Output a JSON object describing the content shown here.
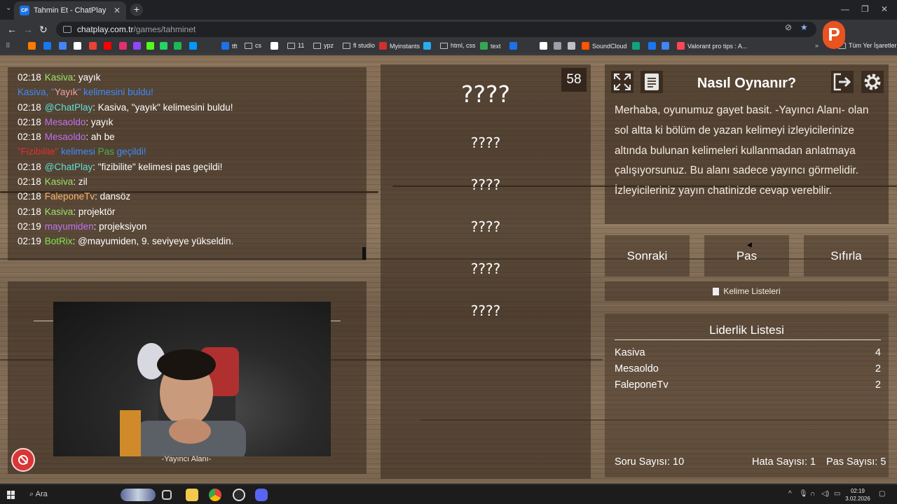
{
  "browser": {
    "tab_title": "Tahmin Et - ChatPlay",
    "tab_favicon": "CP",
    "url_site": "chatplay.com.tr",
    "url_path": "/games/tahminet",
    "profile_letter": "P",
    "all_bookmarks_label": "Tüm Yer İşaretleri"
  },
  "bookmarks": [
    {
      "label": "",
      "color": "#ff7a00"
    },
    {
      "label": "",
      "color": "#1877f2"
    },
    {
      "label": "",
      "color": "#4285f4"
    },
    {
      "label": "",
      "color": "#ffffff"
    },
    {
      "label": "",
      "color": "#ea4335"
    },
    {
      "label": "",
      "color": "#ff0000"
    },
    {
      "label": "",
      "color": "#e1306c"
    },
    {
      "label": "",
      "color": "#9146ff"
    },
    {
      "label": "",
      "color": "#53fc18"
    },
    {
      "label": "",
      "color": "#25d366"
    },
    {
      "label": "",
      "color": "#1db954"
    },
    {
      "label": "",
      "color": "#0099ff"
    },
    {
      "label": "tft",
      "color": "#1a73e8"
    },
    {
      "label": "cs",
      "folder": true
    },
    {
      "label": "",
      "color": "#ffffff"
    },
    {
      "label": "11",
      "folder": true
    },
    {
      "label": "ypz",
      "folder": true
    },
    {
      "label": "fl studio",
      "folder": true
    },
    {
      "label": "Myinstants",
      "color": "#d32f2f"
    },
    {
      "label": "",
      "color": "#2aabee"
    },
    {
      "label": "html, css",
      "folder": true
    },
    {
      "label": "text",
      "color": "#34a853"
    },
    {
      "label": "",
      "color": "#1a73e8"
    },
    {
      "label": "",
      "color": "#ffffff"
    },
    {
      "label": "",
      "color": "#9aa0a6"
    },
    {
      "label": "",
      "color": "#bdc1c6"
    },
    {
      "label": "SoundCloud",
      "color": "#ff5500"
    },
    {
      "label": "",
      "color": "#10a37f"
    },
    {
      "label": "",
      "color": "#1877f2"
    },
    {
      "label": "",
      "color": "#4285f4"
    },
    {
      "label": "Valorant pro tips : A...",
      "color": "#ff4655"
    }
  ],
  "chat": [
    {
      "time": "02:18",
      "user": "Kasiva",
      "user_color": "#9be36b",
      "text": ": yayık"
    },
    {
      "time": "",
      "user": "Kasiva, \"",
      "user_color": "#3d8bff",
      "text": "",
      "special": "Yayık",
      "special_color": "#f0a3a3",
      "tail": "\" kelimesini buldu!",
      "tail_color": "#3d8bff"
    },
    {
      "time": "02:18",
      "user": "@ChatPlay",
      "user_color": "#5ee0d4",
      "text": ": Kasiva, \"yayık\" kelimesini buldu!"
    },
    {
      "time": "02:18",
      "user": "Mesaoldo",
      "user_color": "#c070f0",
      "text": ": yayık"
    },
    {
      "time": "02:18",
      "user": "Mesaoldo",
      "user_color": "#c070f0",
      "text": ": ah be"
    },
    {
      "time": "",
      "user": "\"Fizibilite\"",
      "user_color": "#e03030",
      "text": "",
      "special": " kelimesi ",
      "special_color": "#3d8bff",
      "tail": "Pas",
      "tail_color": "#4caf50",
      "tail2": " geçildi!",
      "tail2_color": "#3d8bff"
    },
    {
      "time": "02:18",
      "user": "@ChatPlay",
      "user_color": "#5ee0d4",
      "text": ": \"fizibilite\" kelimesi pas geçildi!"
    },
    {
      "time": "02:18",
      "user": "Kasiva",
      "user_color": "#9be36b",
      "text": ": zil"
    },
    {
      "time": "02:18",
      "user": "FaleponeTv",
      "user_color": "#ffb36b",
      "text": ": dansöz"
    },
    {
      "time": "02:18",
      "user": "Kasiva",
      "user_color": "#9be36b",
      "text": ": projektör"
    },
    {
      "time": "02:19",
      "user": "mayumiden",
      "user_color": "#c070f0",
      "text": ": projeksiyon"
    },
    {
      "time": "02:19",
      "user": "BotRix",
      "user_color": "#7ee84a",
      "text": ": @mayumiden, 9. seviyeye yükseldin."
    }
  ],
  "streamer": {
    "label": "-Yayıncı Alanı-"
  },
  "game": {
    "timer": "58",
    "words": [
      "????",
      "????",
      "????",
      "????",
      "????",
      "????"
    ]
  },
  "howto": {
    "title": "Nasıl Oynanır?",
    "text": "Merhaba, oyunumuz gayet basit. -Yayıncı Alanı- olan sol altta ki bölüm de yazan kelimeyi izleyicilerinize altında bulunan kelimeleri kullanmadan anlatmaya çalışıyorsunuz. Bu alanı sadece yayıncı görmelidir. İzleyicileriniz yayın chatinizde cevap verebilir."
  },
  "controls": {
    "next": "Sonraki",
    "pass": "Pas",
    "reset": "Sıfırla",
    "word_lists": "Kelime Listeleri"
  },
  "leaderboard": {
    "title": "Liderlik Listesi",
    "rows": [
      {
        "name": "Kasiva",
        "score": "4"
      },
      {
        "name": "Mesaoldo",
        "score": "2"
      },
      {
        "name": "FaleponeTv",
        "score": "2"
      }
    ]
  },
  "stats": {
    "questions": "Soru Sayısı: 10",
    "errors": "Hata Sayısı: 1",
    "passes": "Pas Sayısı: 5"
  },
  "taskbar": {
    "search": "Ara",
    "time": "02:19",
    "date": "3.02.2026"
  }
}
